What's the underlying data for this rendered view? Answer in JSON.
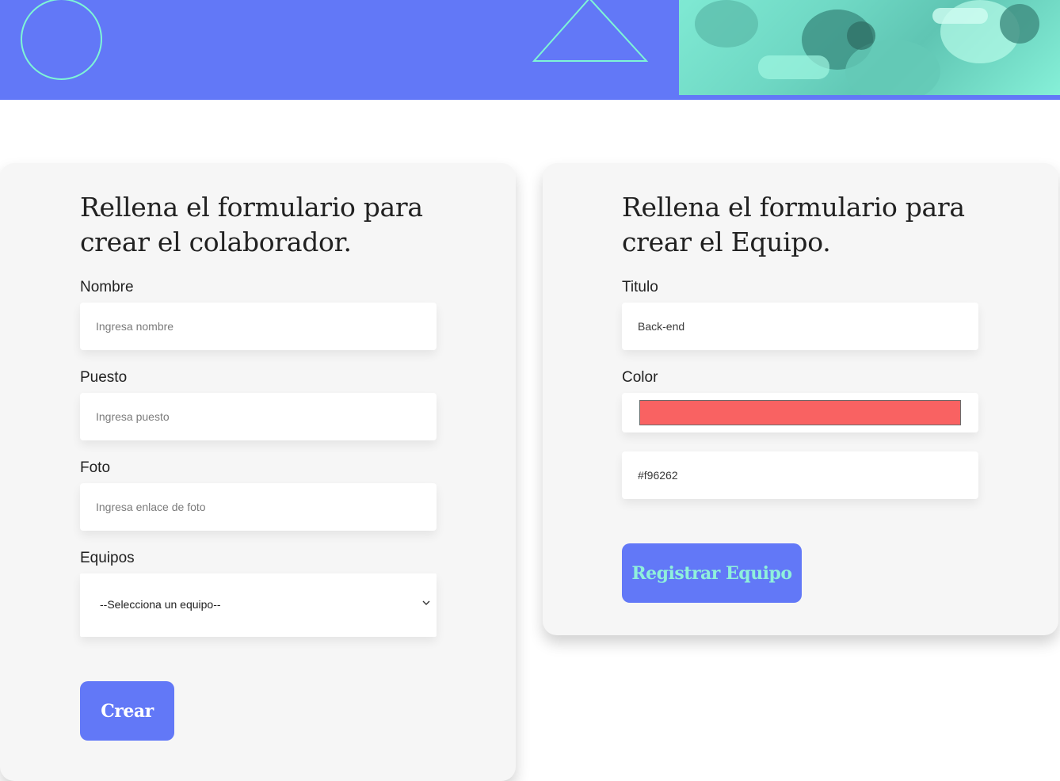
{
  "colors": {
    "primary": "#6278f7",
    "accent": "#7ef5d6",
    "card_bg": "#f6f6f6",
    "selected_color": "#f96262"
  },
  "banner": {
    "icons": [
      "circle-outline-icon",
      "triangle-outline-icon"
    ],
    "photo": "team-hands-photo"
  },
  "collaborator_form": {
    "title": "Rellena el formulario para crear el colaborador.",
    "fields": [
      {
        "label": "Nombre",
        "placeholder": "Ingresa nombre",
        "value": ""
      },
      {
        "label": "Puesto",
        "placeholder": "Ingresa puesto",
        "value": ""
      },
      {
        "label": "Foto",
        "placeholder": "Ingresa enlace de foto",
        "value": ""
      }
    ],
    "teams": {
      "label": "Equipos",
      "selected": "--Selecciona un equipo--"
    },
    "submit_label": "Crear"
  },
  "team_form": {
    "title": "Rellena el formulario para crear el Equipo.",
    "title_field": {
      "label": "Titulo",
      "value": "Back-end"
    },
    "color_field": {
      "label": "Color",
      "swatch": "#f96262",
      "hex_value": "#f96262"
    },
    "submit_label": "Registrar Equipo"
  }
}
